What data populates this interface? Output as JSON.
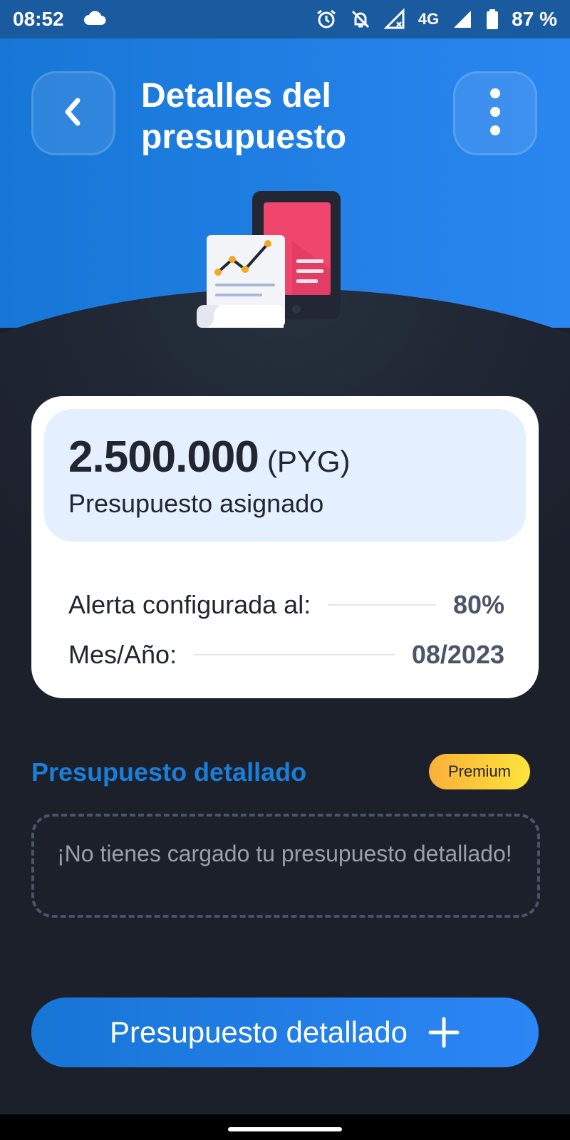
{
  "status_bar": {
    "time": "08:52",
    "network": "4G",
    "battery": "87 %",
    "icons": [
      "cloud-icon",
      "alarm-icon",
      "notifications-off-icon",
      "signal-x-icon",
      "signal-icon",
      "battery-icon"
    ]
  },
  "header": {
    "title": "Detalles del presupuesto",
    "back_icon": "chevron-left-icon",
    "menu_icon": "more-vertical-icon"
  },
  "budget_card": {
    "amount": "2.500.000",
    "currency": "(PYG)",
    "amount_label": "Presupuesto asignado",
    "alert_label": "Alerta configurada al:",
    "alert_value": "80%",
    "month_label": "Mes/Año:",
    "month_value": "08/2023"
  },
  "detailed_section": {
    "title": "Presupuesto detallado",
    "badge": "Premium",
    "empty_message": "¡No tienes cargado tu presupuesto detallado!"
  },
  "add_button": {
    "label": "Presupuesto detallado",
    "icon": "plus-icon"
  },
  "colors": {
    "header_start": "#1677d6",
    "header_end": "#2a86f0",
    "background": "#1c202b",
    "accent": "#1b7ed8",
    "premium_start": "#f9b03a",
    "premium_end": "#fde43b"
  }
}
